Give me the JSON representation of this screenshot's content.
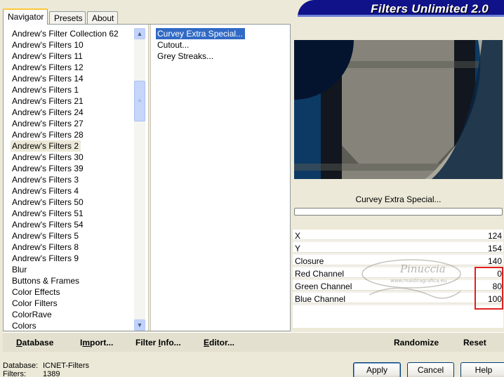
{
  "tabs": [
    {
      "label": "Navigator",
      "active": true
    },
    {
      "label": "Presets",
      "active": false
    },
    {
      "label": "About",
      "active": false
    }
  ],
  "banner": {
    "title": "Filters Unlimited 2.0"
  },
  "categories": {
    "items": [
      "Andrew's Filter Collection 62",
      "Andrew's Filters 10",
      "Andrew's Filters 11",
      "Andrew's Filters 12",
      "Andrew's Filters 14",
      "Andrew's Filters 1",
      "Andrew's Filters 21",
      "Andrew's Filters 24",
      "Andrew's Filters 27",
      "Andrew's Filters 28",
      "Andrew's Filters 2",
      "Andrew's Filters 30",
      "Andrew's Filters 39",
      "Andrew's Filters 3",
      "Andrew's Filters 4",
      "Andrew's Filters 50",
      "Andrew's Filters 51",
      "Andrew's Filters 54",
      "Andrew's Filters 5",
      "Andrew's Filters 8",
      "Andrew's Filters 9",
      "Blur",
      "Buttons & Frames",
      "Color Effects",
      "Color Filters",
      "ColorRave",
      "Colors"
    ],
    "selected": "Andrew's Filters 2"
  },
  "filters": {
    "items": [
      "Curvey Extra Special...",
      "Cutout...",
      "Grey Streaks..."
    ],
    "selected": "Curvey Extra Special..."
  },
  "bottom_bar": {
    "database": {
      "underline": "D",
      "rest": "atabase"
    },
    "import": {
      "pre": "I",
      "underline": "m",
      "rest": "port..."
    },
    "filter_info": {
      "pre": "Filter ",
      "underline": "I",
      "rest": "nfo..."
    },
    "editor": {
      "underline": "E",
      "rest": "ditor..."
    },
    "randomize": "Randomize",
    "reset": "Reset"
  },
  "preview": {
    "filter_name": "Curvey Extra Special..."
  },
  "parameters": [
    {
      "label": "X",
      "value": "124"
    },
    {
      "label": "Y",
      "value": "154"
    },
    {
      "label": "Closure",
      "value": "140"
    },
    {
      "label": "Red Channel",
      "value": "0"
    },
    {
      "label": "Green Channel",
      "value": "80"
    },
    {
      "label": "Blue Channel",
      "value": "100"
    }
  ],
  "watermark": {
    "text": "Pinuccia",
    "subtext": "www.maidiragrafica.eu"
  },
  "status": {
    "database_label": "Database:",
    "database_value": "ICNET-Filters",
    "filters_label": "Filters:",
    "filters_value": "1389"
  },
  "buttons": {
    "apply": "Apply",
    "cancel": "Cancel",
    "help": "Help"
  },
  "colors": {
    "banner": "#10128a",
    "selection": "#316ac5",
    "highlight": "#e0201c"
  }
}
